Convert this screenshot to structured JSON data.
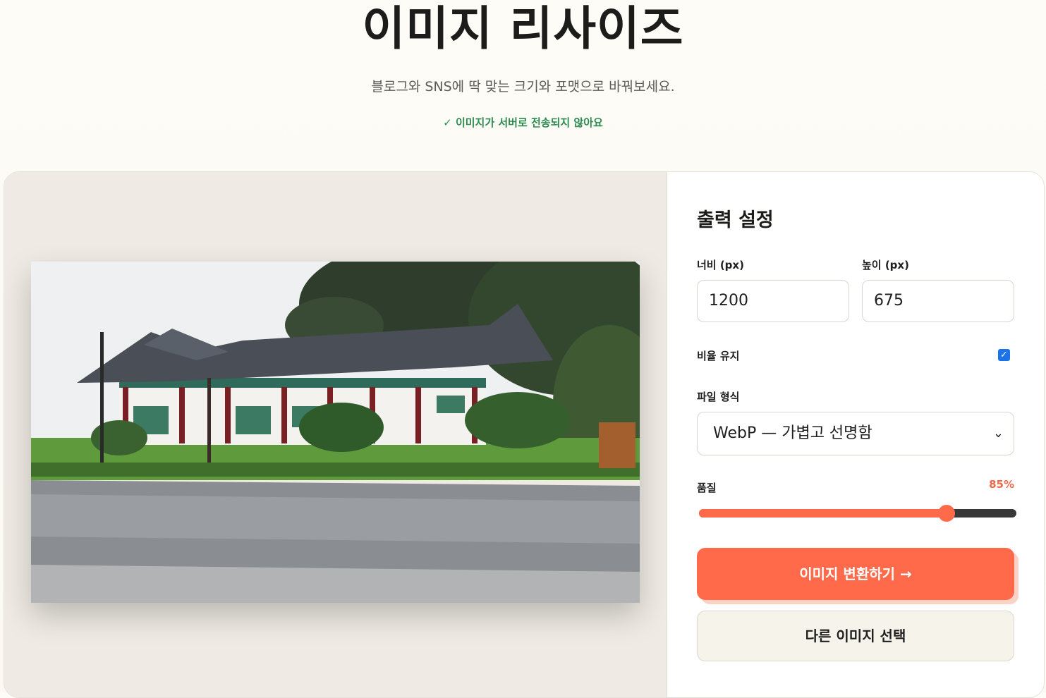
{
  "header": {
    "title": "이미지 리사이즈",
    "subtitle": "블로그와 SNS에 딱 맞는 크기와 포맷으로 바꿔보세요.",
    "privacy_note": "✓ 이미지가 서버로 전송되지 않아요"
  },
  "settings": {
    "title": "출력 설정",
    "width_label": "너비 (px)",
    "width_value": "1200",
    "height_label": "높이 (px)",
    "height_value": "675",
    "keep_ratio_label": "비율 유지",
    "keep_ratio_checked": true,
    "format_label": "파일 형식",
    "format_value": "WebP — 가볍고 선명함",
    "quality_label": "품질",
    "quality_text": "85%",
    "quality_value": 85,
    "convert_button": "이미지 변환하기 →",
    "choose_other_button": "다른 이미지 선택"
  },
  "colors": {
    "accent": "#ff6a4a",
    "success": "#2f8a4f",
    "checkbox": "#1a73e8"
  },
  "preview": {
    "image_icon": "preview-photo"
  }
}
